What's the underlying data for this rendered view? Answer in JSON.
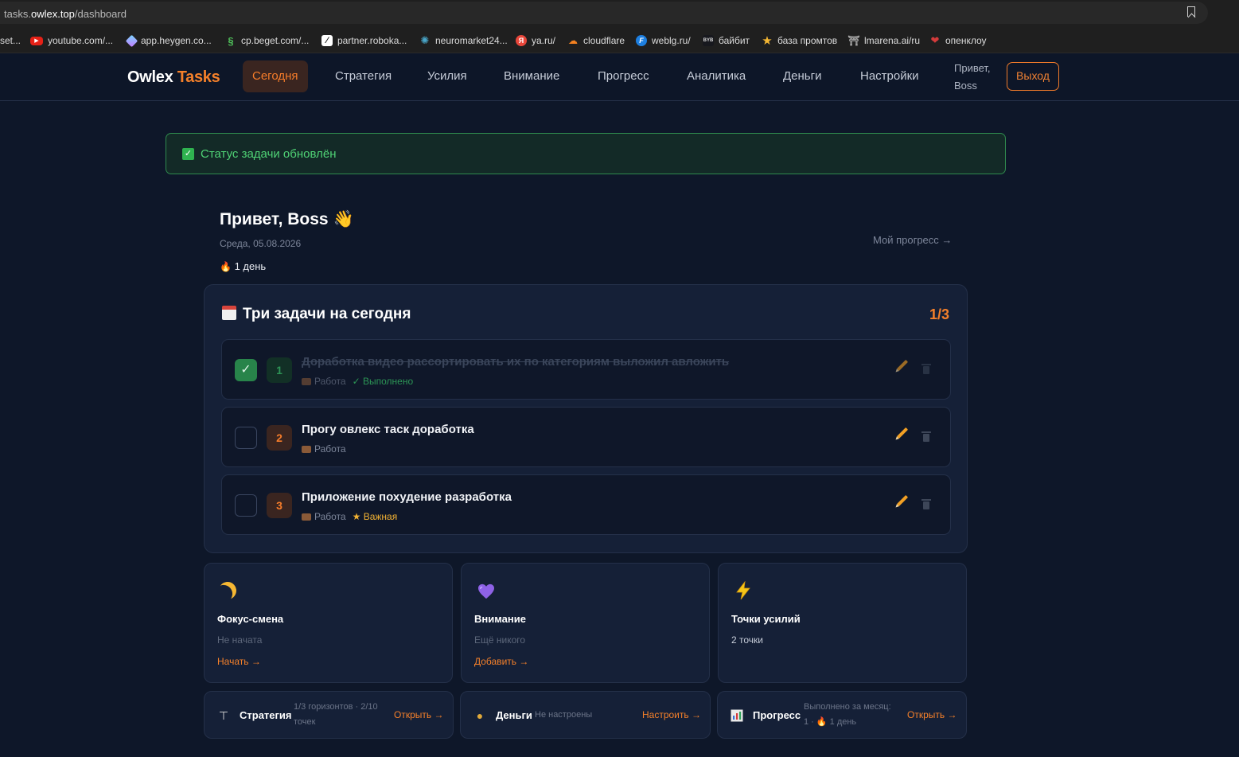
{
  "browser": {
    "url_host_prefix": "tasks.",
    "url_host_main": "owlex.top",
    "url_path": "/dashboard",
    "bookmarks": [
      {
        "label": "set...",
        "icon": "setting-icon",
        "color": "#3b6fd6"
      },
      {
        "label": "youtube.com/...",
        "icon": "youtube-icon",
        "color": "#e62117"
      },
      {
        "label": "app.heygen.co...",
        "icon": "heygen-icon",
        "color": "#2ab7a9"
      },
      {
        "label": "cp.beget.com/...",
        "icon": "beget-icon",
        "color": "#4fbf5a"
      },
      {
        "label": "partner.roboka...",
        "icon": "robokassa-icon",
        "color": "#111111"
      },
      {
        "label": "neuromarket24...",
        "icon": "neuromarket-icon",
        "color": "#3a8fb8"
      },
      {
        "label": "ya.ru/",
        "icon": "yandex-icon",
        "color": "#e8463a"
      },
      {
        "label": "cloudflare",
        "icon": "cloudflare-icon",
        "color": "#f48120"
      },
      {
        "label": "weblg.ru/",
        "icon": "weblg-icon",
        "color": "#1d7fe0"
      },
      {
        "label": "байбит",
        "icon": "bybit-icon",
        "color": "#17181e"
      },
      {
        "label": "база промтов",
        "icon": "star-icon",
        "color": "#f5b733"
      },
      {
        "label": "lmarena.ai/ru",
        "icon": "lmarena-icon",
        "color": "#8a8a8a"
      },
      {
        "label": "опенклоу",
        "icon": "openclaw-icon",
        "color": "#d43b3b"
      }
    ]
  },
  "header": {
    "logo_main": "Owlex",
    "logo_accent": "Tasks",
    "nav": [
      {
        "label": "Сегодня",
        "active": true
      },
      {
        "label": "Стратегия",
        "active": false
      },
      {
        "label": "Усилия",
        "active": false
      },
      {
        "label": "Внимание",
        "active": false
      },
      {
        "label": "Прогресс",
        "active": false
      },
      {
        "label": "Аналитика",
        "active": false
      },
      {
        "label": "Деньги",
        "active": false
      },
      {
        "label": "Настройки",
        "active": false
      }
    ],
    "greeting_line1": "Привет,",
    "greeting_line2": "Boss",
    "logout": "Выход"
  },
  "alert": {
    "icon": "check-icon",
    "text": "Статус задачи обновлён"
  },
  "welcome": {
    "title": "Привет, Boss",
    "wave": "👋",
    "date": "Среда, 05.08.2026",
    "streak_icon": "🔥",
    "streak": "1 день",
    "my_progress": "Мой прогресс →"
  },
  "tasks": {
    "title": "Три задачи на сегодня",
    "count": "1/3",
    "items": [
      {
        "num": "1",
        "title": "Доработка видео рассортировать их по категориям выложил авложить",
        "category": "Работа",
        "status": "✓ Выполнено",
        "done": true,
        "important": ""
      },
      {
        "num": "2",
        "title": "Прогу овлекс таск доработка",
        "category": "Работа",
        "status": "",
        "done": false,
        "important": ""
      },
      {
        "num": "3",
        "title": "Приложение похудение разработка",
        "category": "Работа",
        "status": "",
        "done": false,
        "important": "★  Важная"
      }
    ]
  },
  "cards": [
    {
      "title": "Фокус-смена",
      "sub": "Не начата",
      "link": "Начать →",
      "icon": "moon-icon"
    },
    {
      "title": "Внимание",
      "sub": "Ещё никого",
      "link": "Добавить →",
      "icon": "heart-icon"
    },
    {
      "title": "Точки усилий",
      "sub": "2 точки",
      "link": "",
      "icon": "bolt-icon"
    }
  ],
  "strips": [
    {
      "title": "Стратегия",
      "sub1": "1/3 горизонтов · 2/10",
      "sub2": "точек",
      "link": "Открыть →",
      "icon": "telescope-icon"
    },
    {
      "title": "Деньги",
      "sub1": "Не настроены",
      "sub2": "",
      "link": "Настроить →",
      "icon": "money-bag-icon"
    },
    {
      "title": "Прогресс",
      "sub1": "Выполнено за месяц:",
      "sub2": "1 · 🔥 1 день",
      "link": "Открыть →",
      "icon": "chart-icon"
    }
  ]
}
